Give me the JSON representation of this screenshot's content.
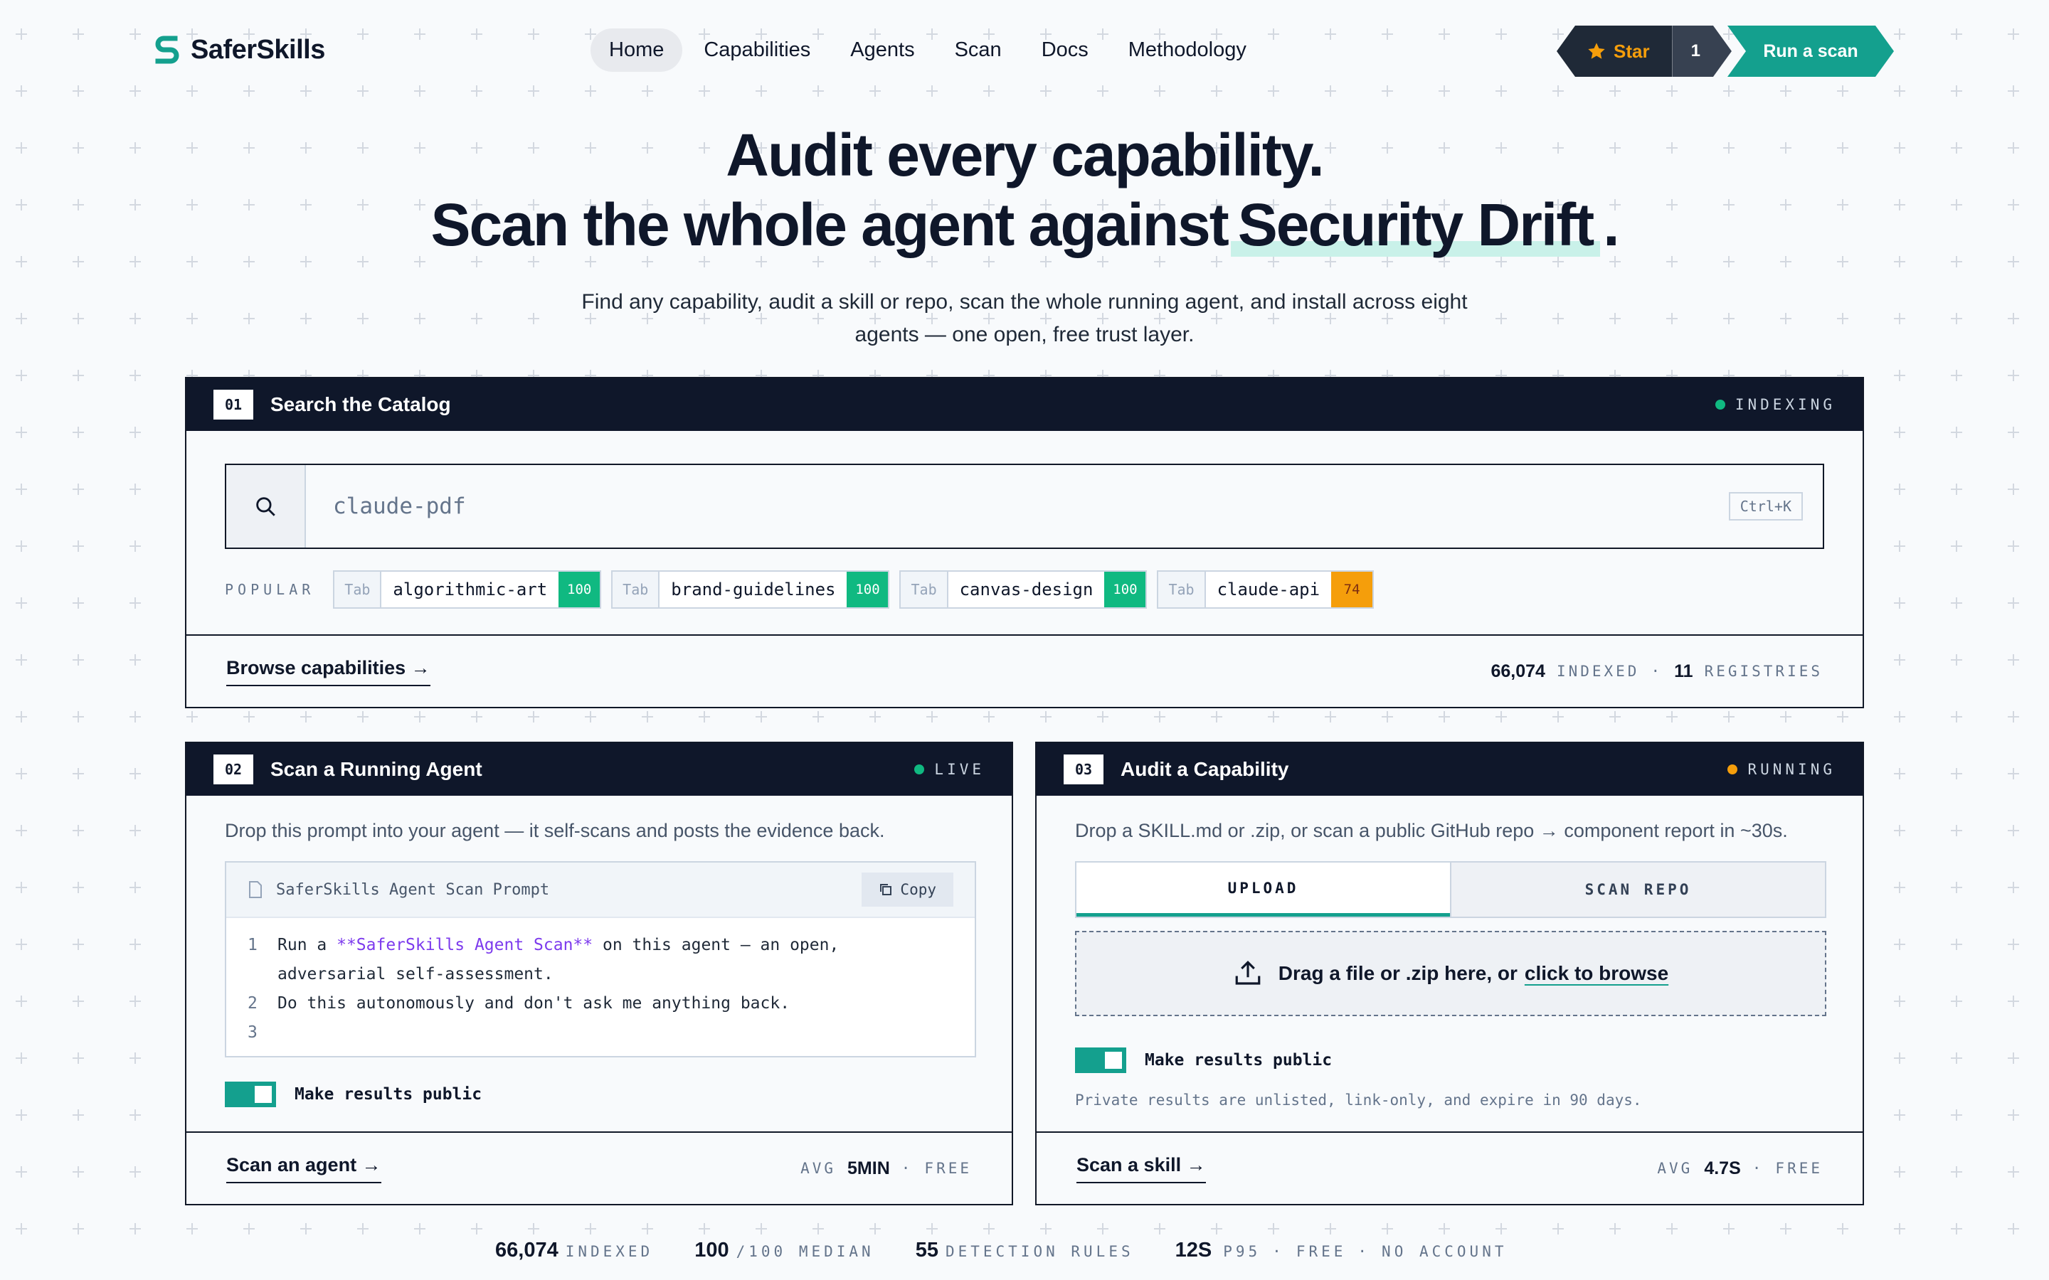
{
  "header": {
    "brand": "SaferSkills",
    "nav": [
      {
        "label": "Home",
        "active": true
      },
      {
        "label": "Capabilities"
      },
      {
        "label": "Agents"
      },
      {
        "label": "Scan"
      },
      {
        "label": "Docs"
      },
      {
        "label": "Methodology"
      }
    ],
    "star_label": "Star",
    "star_count": "1",
    "cta": "Run a scan"
  },
  "hero": {
    "line1": "Audit every capability.",
    "line2_prefix": "Scan the whole agent against",
    "line2_highlight": "Security Drift",
    "line2_suffix": ".",
    "subtitle": "Find any capability, audit a skill or repo, scan the whole running agent, and install across eight agents — one open, free trust layer."
  },
  "catalog": {
    "num": "01",
    "title": "Search the Catalog",
    "status": "INDEXING",
    "status_color": "#10b981",
    "search_value": "claude-pdf",
    "shortcut": "Ctrl+K",
    "popular_label": "POPULAR",
    "chips": [
      {
        "tab": "Tab",
        "name": "algorithmic-art",
        "score": "100",
        "color": "#10b981"
      },
      {
        "tab": "Tab",
        "name": "brand-guidelines",
        "score": "100",
        "color": "#10b981"
      },
      {
        "tab": "Tab",
        "name": "canvas-design",
        "score": "100",
        "color": "#10b981"
      },
      {
        "tab": "Tab",
        "name": "claude-api",
        "score": "74",
        "color": "#f59e0b"
      }
    ],
    "browse": "Browse capabilities →",
    "indexed_count": "66,074",
    "indexed_label": "INDEXED",
    "sep": "·",
    "registries_count": "11",
    "registries_label": "REGISTRIES"
  },
  "agent_scan": {
    "num": "02",
    "title": "Scan a Running Agent",
    "status": "LIVE",
    "status_color": "#10b981",
    "desc": "Drop this prompt into your agent — it self-scans and posts the evidence back.",
    "prompt_title": "SaferSkills Agent Scan Prompt",
    "copy": "Copy",
    "lines": [
      {
        "n": "1",
        "pre": "Run a ",
        "hi": "**SaferSkills Agent Scan**",
        "post": " on this agent — an open,"
      },
      {
        "n": "",
        "pre": "adversarial self-assessment.",
        "hi": "",
        "post": ""
      },
      {
        "n": "2",
        "pre": "Do this autonomously and don't ask me anything back.",
        "hi": "",
        "post": ""
      },
      {
        "n": "3",
        "pre": "",
        "hi": "",
        "post": ""
      }
    ],
    "toggle_label": "Make results public",
    "action": "Scan an agent →",
    "avg_label": "AVG",
    "avg_value": "5MIN",
    "sep": "·",
    "free": "FREE"
  },
  "audit": {
    "num": "03",
    "title": "Audit a Capability",
    "status": "RUNNING",
    "status_color": "#f59e0b",
    "desc": "Drop a SKILL.md or .zip, or scan a public GitHub repo → component report in ~30s.",
    "tabs": [
      "UPLOAD",
      "SCAN REPO"
    ],
    "drop_text": "Drag a file or .zip here, or",
    "drop_link": "click to browse",
    "toggle_label": "Make results public",
    "note": "Private results are unlisted, link-only, and expire in 90 days.",
    "action": "Scan a skill →",
    "avg_label": "AVG",
    "avg_value": "4.7S",
    "sep": "·",
    "free": "FREE"
  },
  "stats": {
    "indexed_value": "66,074",
    "indexed_label": "INDEXED",
    "median_value": "100",
    "median_label": "/100 MEDIAN",
    "rules_value": "55",
    "rules_label": "DETECTION RULES",
    "p95_value": "12S",
    "p95_label": "P95",
    "sep": "·",
    "free": "FREE",
    "no_account": "NO ACCOUNT"
  },
  "colors": {
    "accent": "#14a08e",
    "dark": "#0f172a",
    "star": "#f59e0b"
  }
}
